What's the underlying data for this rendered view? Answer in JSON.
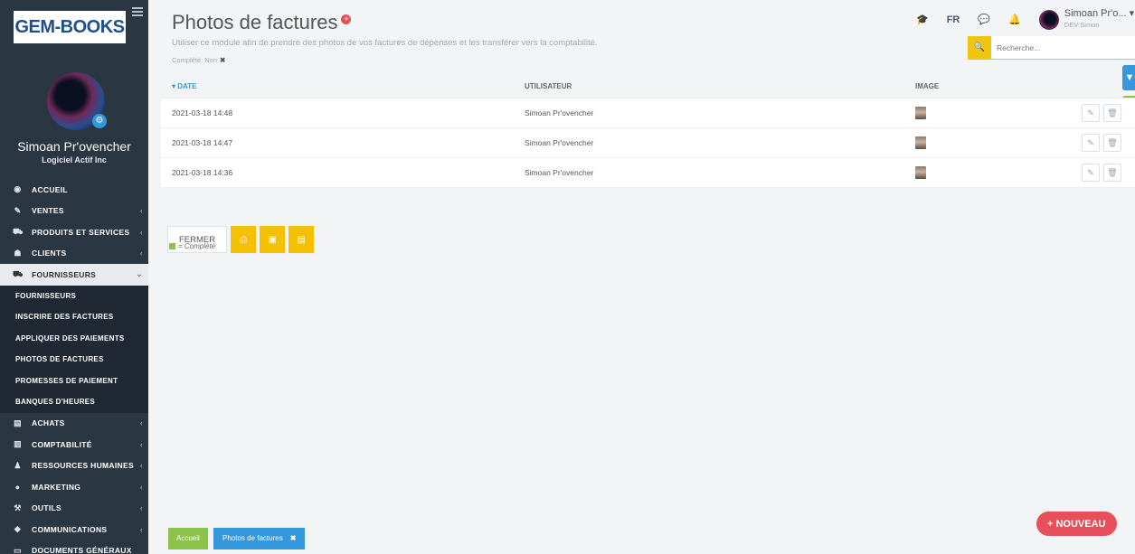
{
  "sidebar": {
    "logo": "GEM-BOOKS",
    "user_name": "Simoan Pr'ovencher",
    "company": "Logiciel Actif Inc",
    "items": [
      {
        "label": "ACCUEIL",
        "icon": "dashboard-icon",
        "glyph": "◉"
      },
      {
        "label": "VENTES",
        "icon": "edit-icon",
        "glyph": "✎"
      },
      {
        "label": "PRODUITS ET SERVICES",
        "icon": "cart-icon",
        "glyph": "⛟"
      },
      {
        "label": "CLIENTS",
        "icon": "users-icon",
        "glyph": "👥"
      },
      {
        "label": "FOURNISSEURS",
        "icon": "truck-icon",
        "glyph": "⛟"
      }
    ],
    "sub_items": [
      {
        "label": "FOURNISSEURS"
      },
      {
        "label": "INSCRIRE DES FACTURES"
      },
      {
        "label": "APPLIQUER DES PAIEMENTS"
      },
      {
        "label": "PHOTOS DE FACTURES"
      },
      {
        "label": "PROMESSES DE PAIEMENT"
      },
      {
        "label": "BANQUES D'HEURES"
      }
    ],
    "items_after": [
      {
        "label": "ACHATS",
        "icon": "list-icon",
        "glyph": "▤"
      },
      {
        "label": "COMPTABILITÉ",
        "icon": "chart-icon",
        "glyph": "▥"
      },
      {
        "label": "RESSOURCES HUMAINES",
        "icon": "user-icon",
        "glyph": "♟"
      },
      {
        "label": "MARKETING",
        "icon": "circle-icon",
        "glyph": "●"
      },
      {
        "label": "OUTILS",
        "icon": "wrench-icon",
        "glyph": "⚒"
      },
      {
        "label": "COMMUNICATIONS",
        "icon": "comments-icon",
        "glyph": "◆"
      },
      {
        "label": "DOCUMENTS GÉNÉRAUX",
        "icon": "folder-icon",
        "glyph": "▭"
      }
    ]
  },
  "header": {
    "title": "Photos de factures",
    "subtitle": "Utiliser ce module afin de prendre des photos de vos factures de dépenses et les transférer vers la comptabilité.",
    "filter": "Complété: Non",
    "lang": "FR",
    "user": "Simoan Pr'o...",
    "user_role": "DEV Simon",
    "search_placeholder": "Recherche..."
  },
  "table": {
    "headers": {
      "date": "DATE",
      "user": "UTILISATEUR",
      "image": "IMAGE"
    },
    "rows": [
      {
        "date": "2021-03-18 14:48",
        "user": "Simoan Pr'ovencher"
      },
      {
        "date": "2021-03-18 14:47",
        "user": "Simoan Pr'ovencher"
      },
      {
        "date": "2021-03-18 14:36",
        "user": "Simoan Pr'ovencher"
      }
    ]
  },
  "buttons": {
    "close": "FERMER",
    "new": "+ NOUVEAU"
  },
  "legend": "= Complété",
  "footer": {
    "home": "Accueil",
    "tab": "Photos de factures"
  },
  "colors": {
    "sidebar": "#2b3643",
    "accent_yellow": "#f5c000",
    "accent_blue": "#3598dc",
    "accent_green": "#8bc34a",
    "accent_red": "#e7505a"
  }
}
